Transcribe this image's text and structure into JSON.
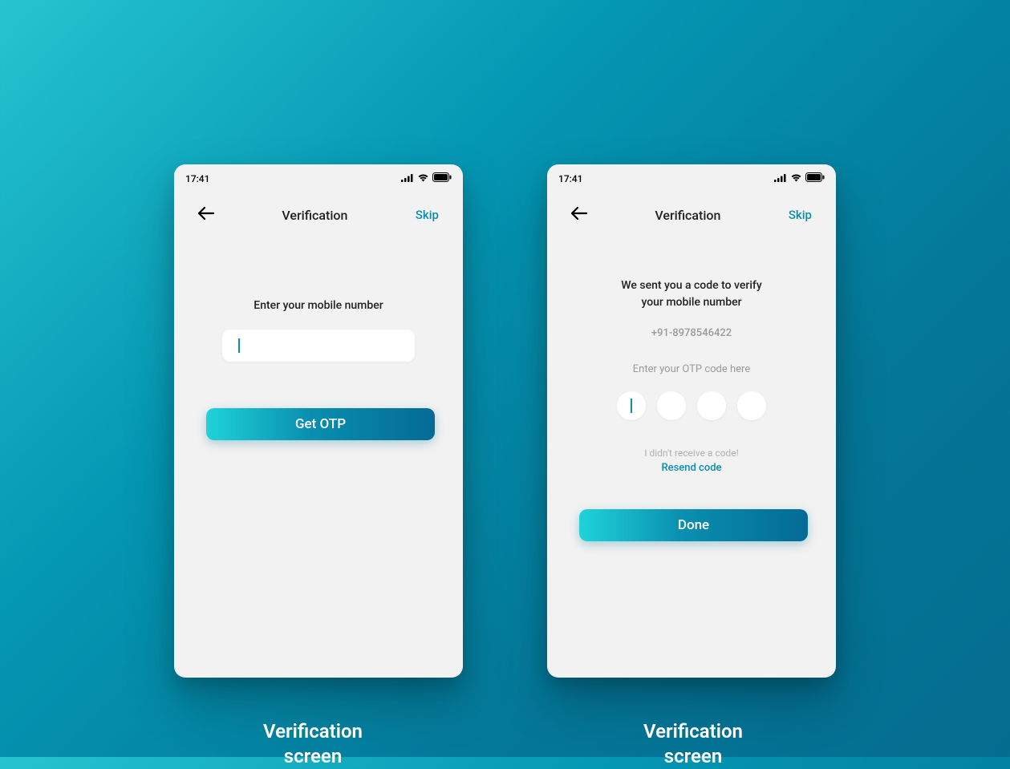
{
  "status": {
    "time": "17:41"
  },
  "nav": {
    "title": "Verification",
    "skip": "Skip"
  },
  "screen1": {
    "prompt": "Enter your mobile number",
    "button": "Get OTP",
    "caption_line1": "Verification",
    "caption_line2": "screen"
  },
  "screen2": {
    "verify_line1": "We sent you a code to verify",
    "verify_line2": "your mobile number",
    "phone": "+91-8978546422",
    "otp_label": "Enter your OTP code here",
    "no_code": "I didn't receive a code!",
    "resend": "Resend code",
    "button": "Done",
    "caption_line1": "Verification",
    "caption_line2": "screen"
  },
  "colors": {
    "accent": "#0a8fb0",
    "gradient_start": "#1fd3d8",
    "gradient_end": "#046a96"
  }
}
